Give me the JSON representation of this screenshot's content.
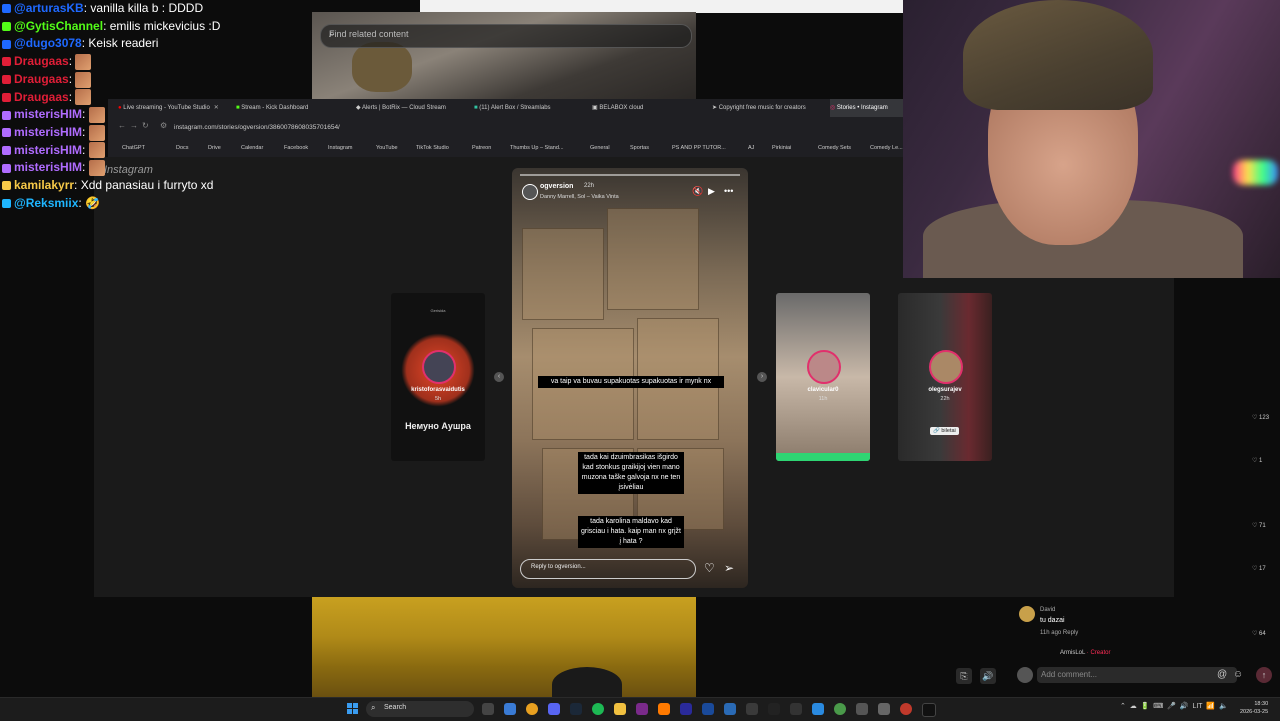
{
  "chat": [
    {
      "user": "@arturasKB",
      "color": "#1f69ff",
      "msg": "vanilla killa b : DDDD",
      "emote": false
    },
    {
      "user": "@GytisChannel",
      "color": "#53fc18",
      "msg": "emilis mickevicius :D",
      "emote": false
    },
    {
      "user": "@dugo3078",
      "color": "#1f69ff",
      "msg": "Keisk readeri",
      "emote": false
    },
    {
      "user": "Draugaas",
      "color": "#e01e37",
      "msg": "",
      "emote": true
    },
    {
      "user": "Draugaas",
      "color": "#e01e37",
      "msg": "",
      "emote": true
    },
    {
      "user": "Draugaas",
      "color": "#e01e37",
      "msg": "",
      "emote": true
    },
    {
      "user": "misterisHIM",
      "color": "#b06cff",
      "msg": "",
      "emote": true
    },
    {
      "user": "misterisHIM",
      "color": "#b06cff",
      "msg": "",
      "emote": true
    },
    {
      "user": "misterisHIM",
      "color": "#b06cff",
      "msg": "",
      "emote": true
    },
    {
      "user": "misterisHIM",
      "color": "#b06cff",
      "msg": "",
      "emote": true
    },
    {
      "user": "kamilakyrr",
      "color": "#f7c948",
      "msg": "Xdd panasiau i furryto xd",
      "emote": false
    },
    {
      "user": "@Reksmiix",
      "color": "#1fb6ff",
      "msg": "🤣",
      "emote": false
    }
  ],
  "bg_search_placeholder": "Find related content",
  "tabs": [
    {
      "label": "Live streaming - YouTube Studio",
      "active": false
    },
    {
      "label": "Stream - Kick Dashboard",
      "active": false
    },
    {
      "label": "Alerts | BotRix — Cloud Stream",
      "active": false
    },
    {
      "label": "(11) Alert Box / Streamlabs",
      "active": false
    },
    {
      "label": "BELABOX cloud",
      "active": false
    },
    {
      "label": "Copyright free music for creators",
      "active": false
    },
    {
      "label": "Stories • Instagram",
      "active": true
    }
  ],
  "url": "instagram.com/stories/ogversion/3860078608035701654/",
  "bookmarks": [
    "ChatGPT",
    "Docs",
    "Drive",
    "Calendar",
    "Facebook",
    "Instagram",
    "YouTube",
    "TikTok Studio",
    "Patreon",
    "Thumbs Up – Stand...",
    "General",
    "Sportas",
    "PS AND PP TUTOR...",
    "AJ",
    "Pirkiniai",
    "Comedy Sets",
    "Comedy Le..."
  ],
  "ig_logo": "Instagram",
  "story": {
    "user": "ogversion",
    "time": "22h",
    "location": "Danny Marrell, Sol – Vaika Vinta",
    "caption1": "va taip va buvau supakuotas supakuotas ir mynk nx",
    "caption2": "tada kai dzuimbrasikas išgirdo kad stonkus graikijoj vien mano muzona taške galvoja nx ne ten įsivėliau",
    "caption3": "tada karolina maldavo kad grisciau i hata. kaip man nx grįžt į hata ?",
    "reply_placeholder": "Reply to ogversion..."
  },
  "side_stories": [
    {
      "user": "kristoforasvaidutis",
      "time": "5h",
      "caption": "Немуно Аушра",
      "top": "Gerisida"
    },
    {
      "user": "clavicular0",
      "time": "11h"
    },
    {
      "user": "olegsurajev",
      "time": "22h",
      "tag": "🔗 biletai"
    }
  ],
  "likes": [
    "123",
    "1",
    "71",
    "17",
    "64"
  ],
  "comment": {
    "user": "David",
    "text": "tu dazai",
    "meta": "11h ago   Reply",
    "reply_user": "ArmisLoL",
    "creator": "· Creator"
  },
  "add_comment_placeholder": "Add comment...",
  "taskbar": {
    "search": "Search",
    "lang": "LIT",
    "time": "18:30",
    "date": "2026-03-25"
  }
}
